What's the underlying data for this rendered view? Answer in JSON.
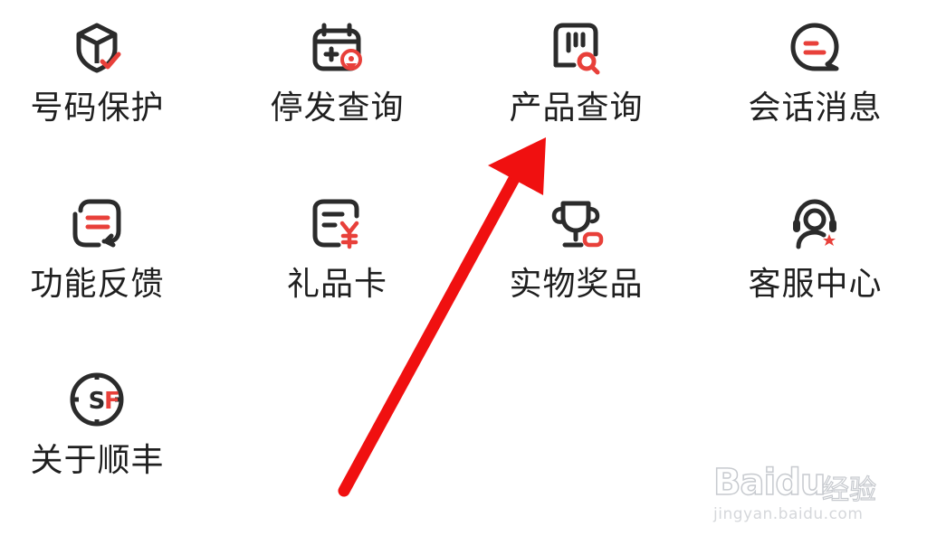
{
  "menu": {
    "items": [
      {
        "label": "号码保护",
        "icon": "box-shield-check-icon"
      },
      {
        "label": "停发查询",
        "icon": "calendar-location-icon"
      },
      {
        "label": "产品查询",
        "icon": "package-search-icon"
      },
      {
        "label": "会话消息",
        "icon": "chat-bubble-icon"
      },
      {
        "label": "功能反馈",
        "icon": "feedback-refresh-icon"
      },
      {
        "label": "礼品卡",
        "icon": "gift-card-yen-icon"
      },
      {
        "label": "实物奖品",
        "icon": "trophy-icon"
      },
      {
        "label": "客服中心",
        "icon": "customer-service-headset-icon"
      },
      {
        "label": "关于顺丰",
        "icon": "sf-logo-icon"
      }
    ]
  },
  "colors": {
    "icon_dark": "#2b2b2b",
    "icon_accent": "#e8403a",
    "arrow": "#f01010"
  },
  "watermark": {
    "logo_text": "Baidu",
    "sub_text": "经验",
    "url": "jingyan.baidu.com"
  }
}
